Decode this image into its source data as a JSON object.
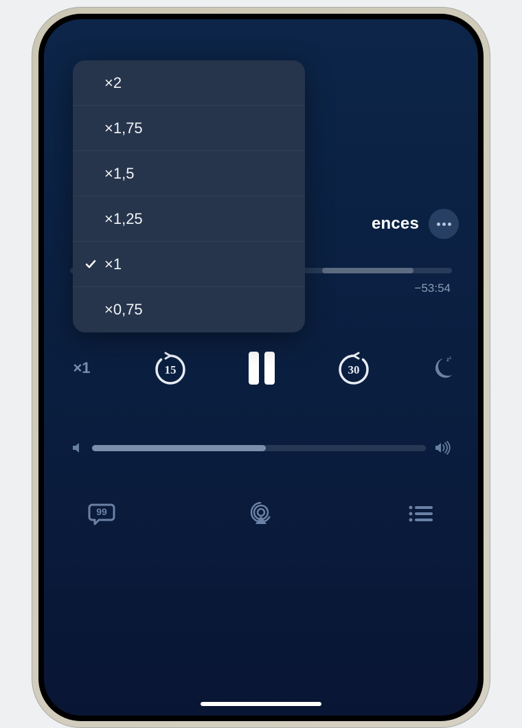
{
  "title_fragment": "ences",
  "time_remaining": "−53:54",
  "speed_label": "×1",
  "skip_back_seconds": "15",
  "skip_forward_seconds": "30",
  "progress_percent": 24,
  "volume_percent": 52,
  "speed_menu": {
    "options": [
      {
        "label": "×2",
        "selected": false
      },
      {
        "label": "×1,75",
        "selected": false
      },
      {
        "label": "×1,5",
        "selected": false
      },
      {
        "label": "×1,25",
        "selected": false
      },
      {
        "label": "×1",
        "selected": true
      },
      {
        "label": "×0,75",
        "selected": false
      }
    ]
  }
}
